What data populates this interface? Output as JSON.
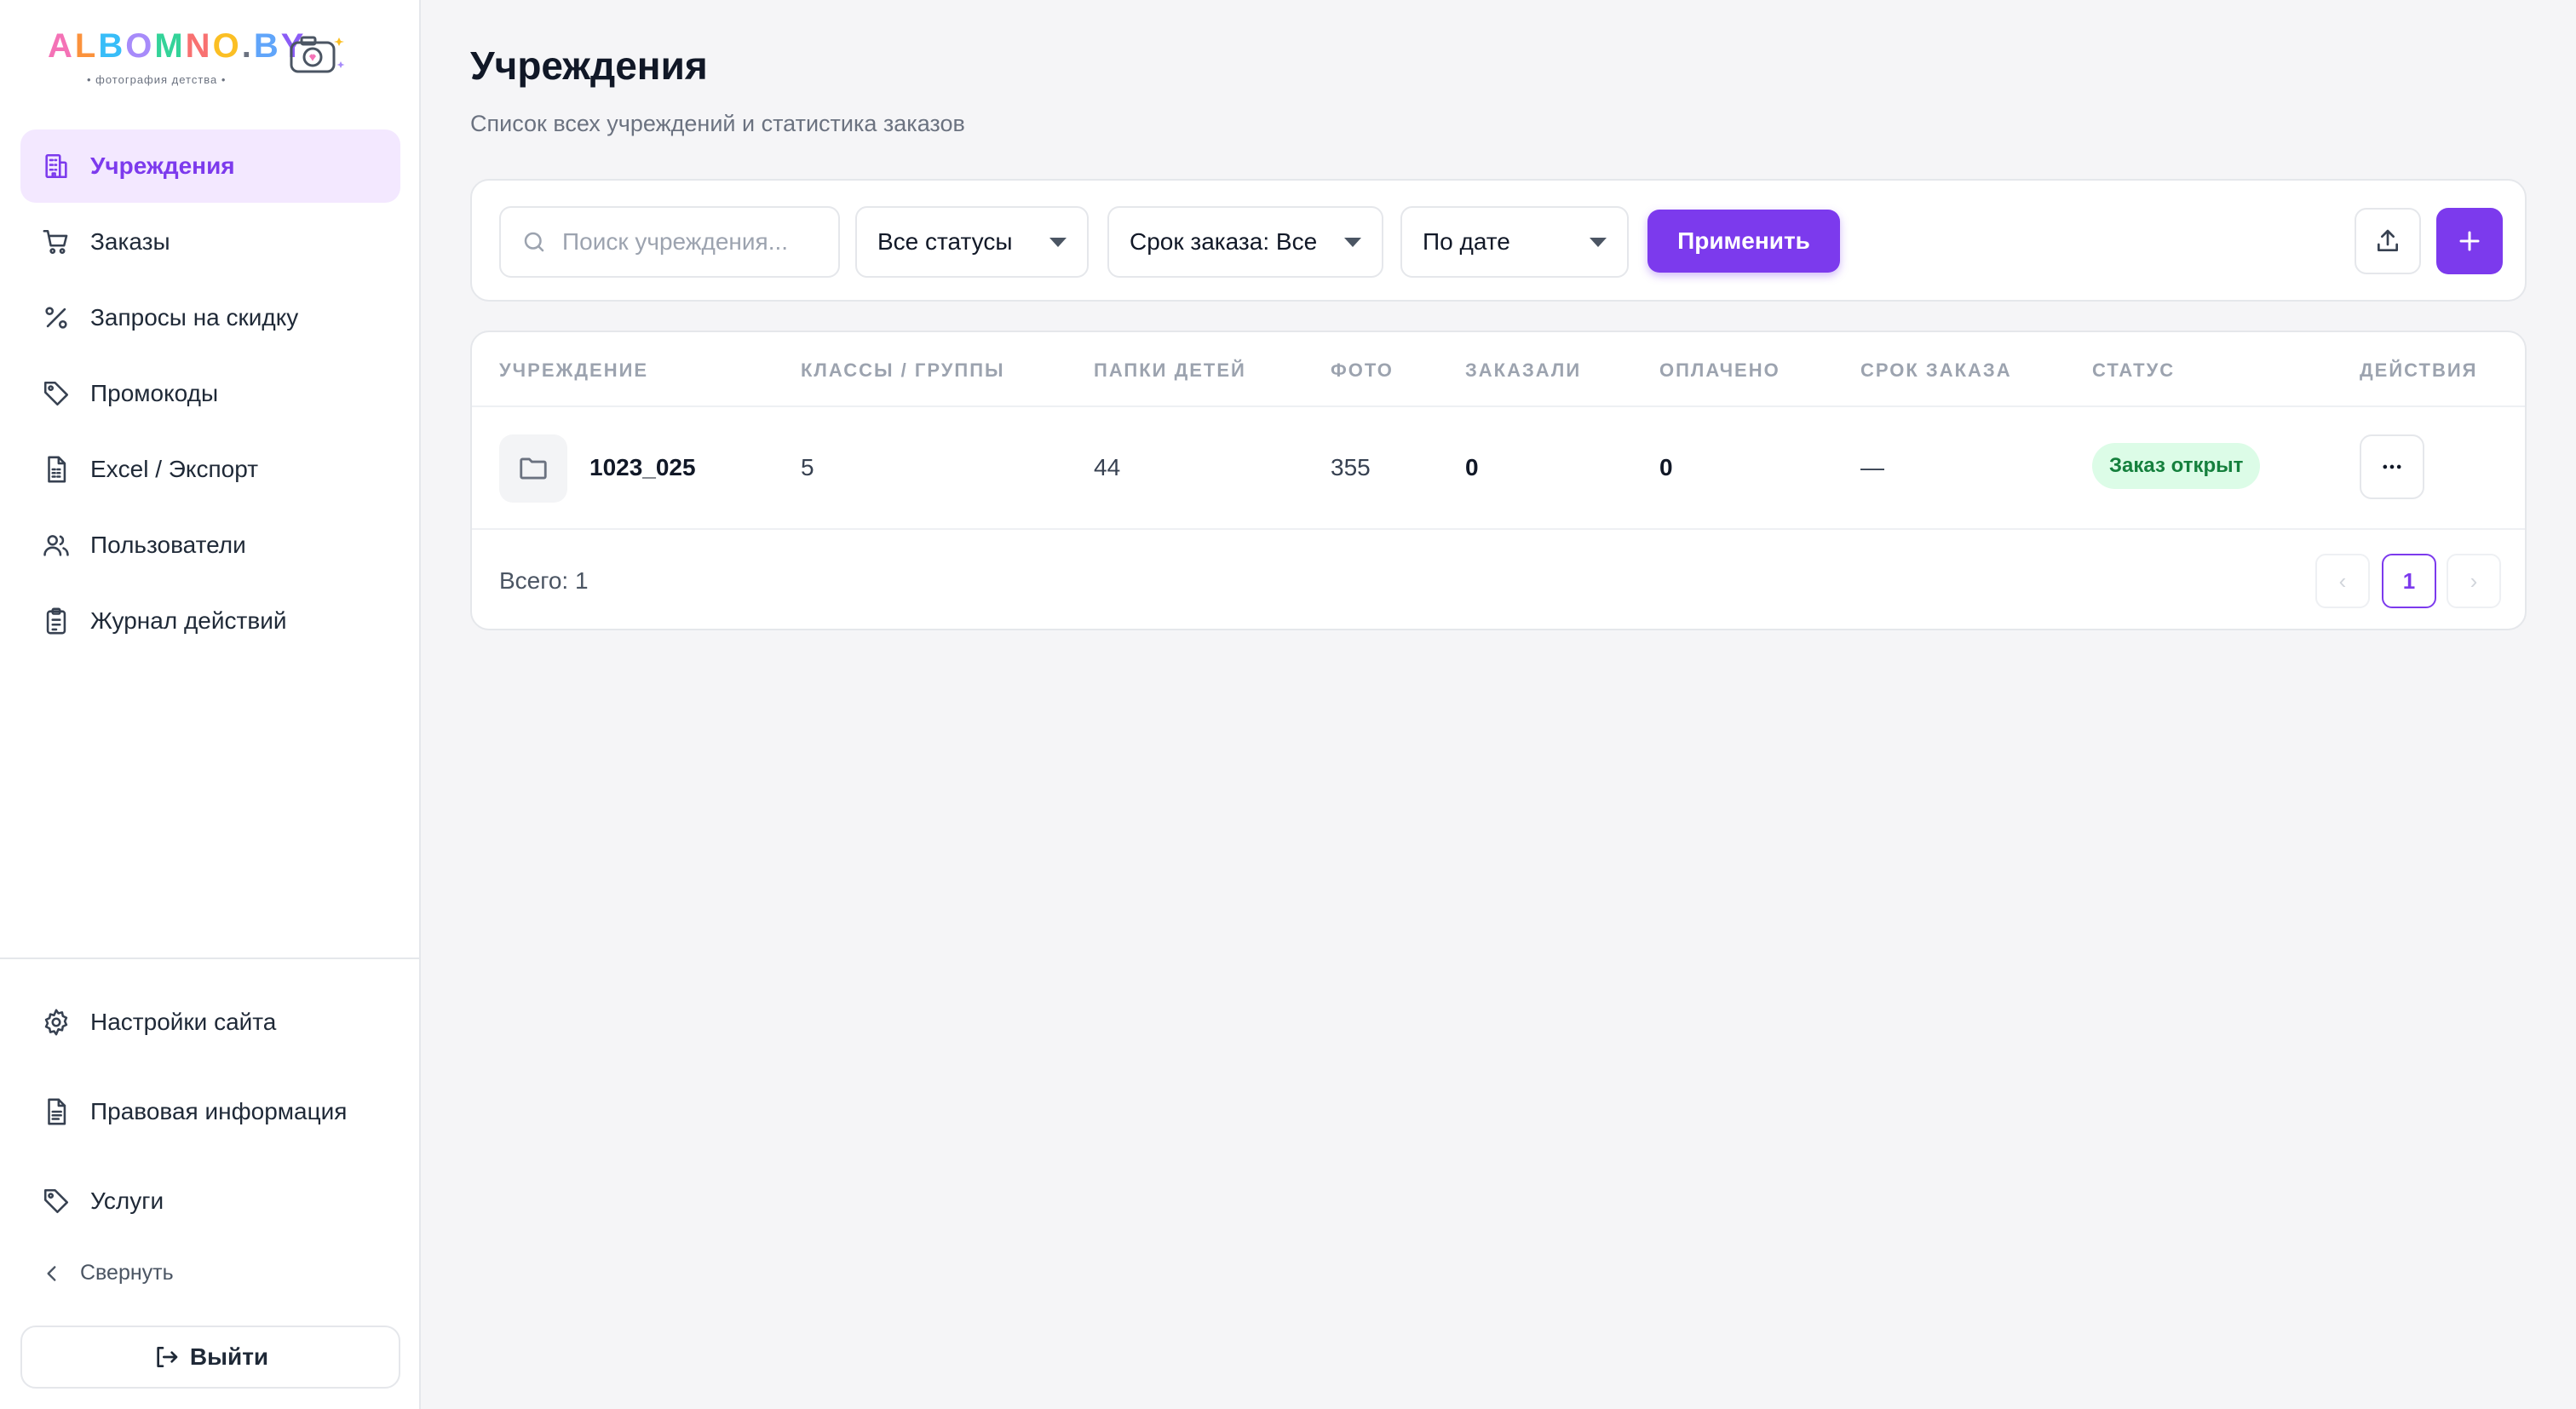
{
  "brand": {
    "logo_letters": [
      {
        "ch": "A",
        "color": "#f472b6"
      },
      {
        "ch": "L",
        "color": "#fb923c"
      },
      {
        "ch": "B",
        "color": "#38bdf8"
      },
      {
        "ch": "O",
        "color": "#a78bfa"
      },
      {
        "ch": "M",
        "color": "#34d399"
      },
      {
        "ch": "N",
        "color": "#f87171"
      },
      {
        "ch": "O",
        "color": "#fbbf24"
      },
      {
        "ch": ".",
        "color": "#6b7280"
      },
      {
        "ch": "B",
        "color": "#60a5fa"
      },
      {
        "ch": "Y",
        "color": "#8b5cf6"
      }
    ],
    "tagline": "• фотография детства •"
  },
  "sidebar": {
    "items": [
      {
        "label": "Учреждения",
        "icon": "building-icon",
        "active": true
      },
      {
        "label": "Заказы",
        "icon": "cart-icon",
        "active": false
      },
      {
        "label": "Запросы на скидку",
        "icon": "percent-icon",
        "active": false
      },
      {
        "label": "Промокоды",
        "icon": "tag-icon",
        "active": false
      },
      {
        "label": "Excel / Экспорт",
        "icon": "spreadsheet-icon",
        "active": false
      },
      {
        "label": "Пользователи",
        "icon": "users-icon",
        "active": false
      },
      {
        "label": "Журнал действий",
        "icon": "clipboard-icon",
        "active": false
      }
    ],
    "bottom_items": [
      {
        "label": "Настройки сайта",
        "icon": "gear-icon"
      },
      {
        "label": "Правовая информация",
        "icon": "document-icon"
      },
      {
        "label": "Услуги",
        "icon": "tag-icon"
      }
    ],
    "collapse_label": "Свернуть",
    "logout_label": "Выйти"
  },
  "header": {
    "title": "Учреждения",
    "subtitle": "Список всех учреждений и статистика заказов"
  },
  "filters": {
    "search_placeholder": "Поиск учреждения...",
    "status_select": "Все статусы",
    "deadline_select": "Срок заказа: Все",
    "sort_select": "По дате",
    "apply_label": "Применить"
  },
  "table": {
    "columns": [
      "УЧРЕЖДЕНИЕ",
      "КЛАССЫ / ГРУППЫ",
      "ПАПКИ ДЕТЕЙ",
      "ФОТО",
      "ЗАКАЗАЛИ",
      "ОПЛАЧЕНО",
      "СРОК ЗАКАЗА",
      "СТАТУС",
      "ДЕЙСТВИЯ"
    ],
    "rows": [
      {
        "name": "1023_025",
        "groups": "5",
        "folders": "44",
        "photos": "355",
        "ordered": "0",
        "paid": "0",
        "deadline": "—",
        "status": "Заказ открыт"
      }
    ],
    "total_label": "Всего: 1",
    "pagination": {
      "prev": "‹",
      "current": "1",
      "next": "›"
    }
  },
  "colors": {
    "accent": "#7c3aed",
    "accent_soft": "#f3e8ff",
    "status_open_bg": "#dcfce7",
    "status_open_text": "#15803d"
  }
}
